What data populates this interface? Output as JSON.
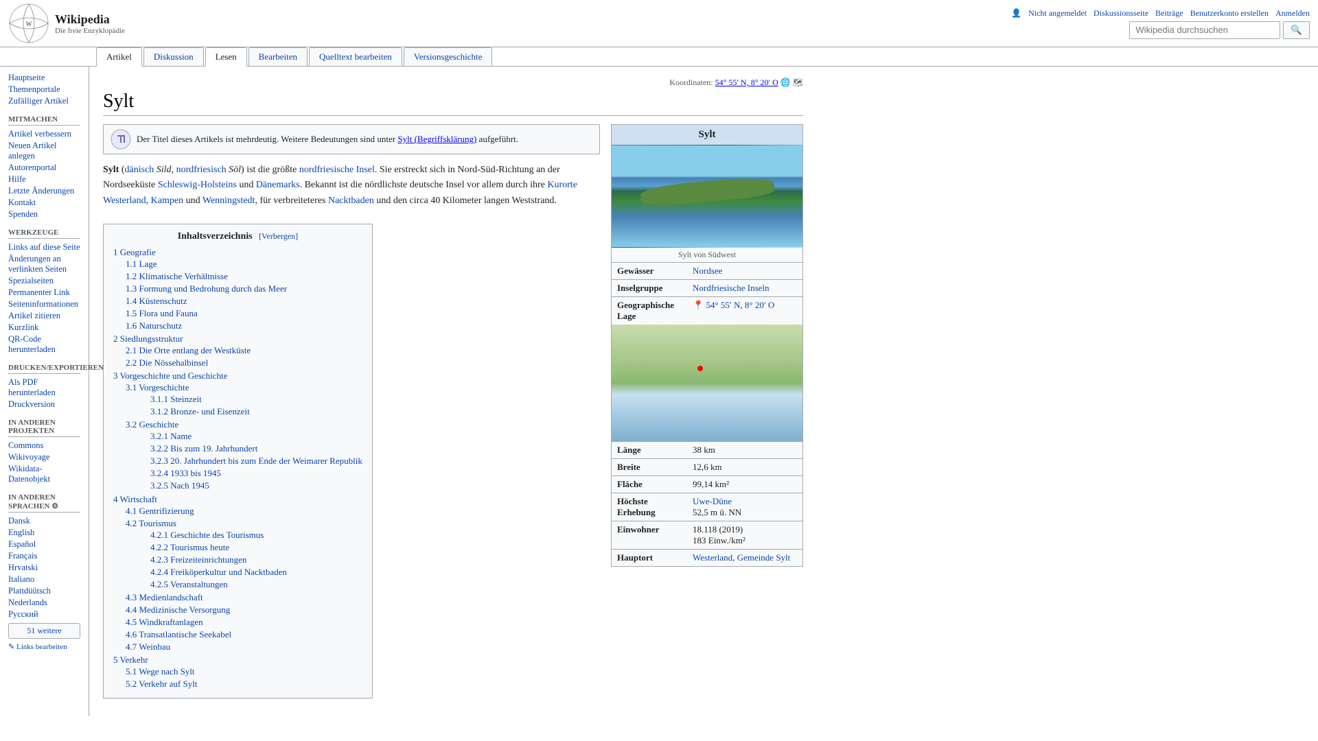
{
  "header": {
    "logo_alt": "Wikipedia",
    "logo_title": "Wikipedia",
    "logo_subtitle": "Die freie Enzyklopädie",
    "user_links": [
      {
        "label": "Nicht angemeldet",
        "href": "#"
      },
      {
        "label": "Diskussionsseite",
        "href": "#"
      },
      {
        "label": "Beiträge",
        "href": "#"
      },
      {
        "label": "Benutzerkonto erstellen",
        "href": "#"
      },
      {
        "label": "Anmelden",
        "href": "#"
      }
    ],
    "search_placeholder": "Wikipedia durchsuchen",
    "search_button_label": "🔍"
  },
  "tabs": [
    {
      "label": "Artikel",
      "active": true
    },
    {
      "label": "Diskussion",
      "active": false
    },
    {
      "label": "Lesen",
      "active": true
    },
    {
      "label": "Bearbeiten",
      "active": false
    },
    {
      "label": "Quelltext bearbeiten",
      "active": false
    },
    {
      "label": "Versionsgeschichte",
      "active": false
    }
  ],
  "sidebar": {
    "sections": [
      {
        "title": "",
        "items": [
          {
            "label": "Hauptseite",
            "href": "#"
          },
          {
            "label": "Themenportale",
            "href": "#"
          },
          {
            "label": "Zufälliger Artikel",
            "href": "#"
          }
        ]
      },
      {
        "title": "Mitmachen",
        "items": [
          {
            "label": "Artikel verbessern",
            "href": "#"
          },
          {
            "label": "Neuen Artikel anlegen",
            "href": "#"
          },
          {
            "label": "Autorenportal",
            "href": "#"
          },
          {
            "label": "Hilfe",
            "href": "#"
          },
          {
            "label": "Letzte Änderungen",
            "href": "#"
          },
          {
            "label": "Kontakt",
            "href": "#"
          },
          {
            "label": "Spenden",
            "href": "#"
          }
        ]
      },
      {
        "title": "Werkzeuge",
        "items": [
          {
            "label": "Links auf diese Seite",
            "href": "#"
          },
          {
            "label": "Änderungen an verlinkten Seiten",
            "href": "#"
          },
          {
            "label": "Spezialseiten",
            "href": "#"
          },
          {
            "label": "Permanenter Link",
            "href": "#"
          },
          {
            "label": "Seiteninformationen",
            "href": "#"
          },
          {
            "label": "Artikel zitieren",
            "href": "#"
          },
          {
            "label": "Kurzlink",
            "href": "#"
          },
          {
            "label": "QR-Code herunterladen",
            "href": "#"
          }
        ]
      },
      {
        "title": "Drucken/exportieren",
        "items": [
          {
            "label": "Als PDF herunterladen",
            "href": "#"
          },
          {
            "label": "Druckversion",
            "href": "#"
          }
        ]
      },
      {
        "title": "In anderen Projekten",
        "items": [
          {
            "label": "Commons",
            "href": "#"
          },
          {
            "label": "Wikivoyage",
            "href": "#"
          },
          {
            "label": "Wikidata-Datenobjekt",
            "href": "#"
          }
        ]
      },
      {
        "title": "In anderen Sprachen",
        "items": [
          {
            "label": "Dansk",
            "href": "#"
          },
          {
            "label": "English",
            "href": "#"
          },
          {
            "label": "Español",
            "href": "#"
          },
          {
            "label": "Français",
            "href": "#"
          },
          {
            "label": "Hrvatski",
            "href": "#"
          },
          {
            "label": "Italiano",
            "href": "#"
          },
          {
            "label": "Plattdüütsch",
            "href": "#"
          },
          {
            "label": "Nederlands",
            "href": "#"
          },
          {
            "label": "Русский",
            "href": "#"
          }
        ],
        "more_label": "51 weitere"
      }
    ],
    "links_bearbeiten": "Links bearbeiten"
  },
  "page": {
    "title": "Sylt",
    "coordinates": "54° 55′ N, 8° 20′ O",
    "disambig_text": "Der Titel dieses Artikels ist mehrdeutig. Weitere Bedeutungen sind unter",
    "disambig_link": "Sylt (Begriffsklärung)",
    "disambig_suffix": "aufgeführt.",
    "intro": "Sylt (dänisch Sild, nordfriesisch Söl) ist die größte nordfriesische Insel. Sie erstreckt sich in Nord-Süd-Richtung an der Nordseeküste Schleswig-Holsteins und Dänemarks. Bekannt ist die nördlichste deutsche Insel vor allem durch ihre Kurorte Westerland, Kampen und Wenningstedt, für verbreiteteres Nacktbaden und den circa 40 Kilometer langen Weststrand."
  },
  "toc": {
    "title": "Inhaltsverzeichnis",
    "hide_label": "[Verbergen]",
    "items": [
      {
        "num": "1",
        "label": "Geografie",
        "sub": [
          {
            "num": "1.1",
            "label": "Lage"
          },
          {
            "num": "1.2",
            "label": "Klimatische Verhältnisse"
          },
          {
            "num": "1.3",
            "label": "Formung und Bedrohung durch das Meer"
          },
          {
            "num": "1.4",
            "label": "Küstenschutz"
          },
          {
            "num": "1.5",
            "label": "Flora und Fauna"
          },
          {
            "num": "1.6",
            "label": "Naturschutz"
          }
        ]
      },
      {
        "num": "2",
        "label": "Siedlungsstruktur",
        "sub": [
          {
            "num": "2.1",
            "label": "Die Orte entlang der Westküste"
          },
          {
            "num": "2.2",
            "label": "Die Nössehalbinsel"
          }
        ]
      },
      {
        "num": "3",
        "label": "Vorgeschichte und Geschichte",
        "sub": [
          {
            "num": "3.1",
            "label": "Vorgeschichte",
            "sub": [
              {
                "num": "3.1.1",
                "label": "Steinzeit"
              },
              {
                "num": "3.1.2",
                "label": "Bronze- und Eisenzeit"
              }
            ]
          },
          {
            "num": "3.2",
            "label": "Geschichte",
            "sub": [
              {
                "num": "3.2.1",
                "label": "Name"
              },
              {
                "num": "3.2.2",
                "label": "Bis zum 19. Jahrhundert"
              },
              {
                "num": "3.2.3",
                "label": "20. Jahrhundert bis zum Ende der Weimarer Republik"
              },
              {
                "num": "3.2.4",
                "label": "1933 bis 1945"
              },
              {
                "num": "3.2.5",
                "label": "Nach 1945"
              }
            ]
          }
        ]
      },
      {
        "num": "4",
        "label": "Wirtschaft",
        "sub": [
          {
            "num": "4.1",
            "label": "Gentrifizierung"
          },
          {
            "num": "4.2",
            "label": "Tourismus",
            "sub": [
              {
                "num": "4.2.1",
                "label": "Geschichte des Tourismus"
              },
              {
                "num": "4.2.2",
                "label": "Tourismus heute"
              },
              {
                "num": "4.2.3",
                "label": "Freizeiteinrichtungen"
              },
              {
                "num": "4.2.4",
                "label": "Freiköperkultur und Nacktbaden"
              },
              {
                "num": "4.2.5",
                "label": "Veranstaltungen"
              }
            ]
          },
          {
            "num": "4.3",
            "label": "Medienlandschaft"
          },
          {
            "num": "4.4",
            "label": "Medizinische Versorgung"
          },
          {
            "num": "4.5",
            "label": "Windkraftanlagen"
          },
          {
            "num": "4.6",
            "label": "Transatlantische Seekabel"
          },
          {
            "num": "4.7",
            "label": "Weinbau"
          }
        ]
      },
      {
        "num": "5",
        "label": "Verkehr",
        "sub": [
          {
            "num": "5.1",
            "label": "Wege nach Sylt"
          },
          {
            "num": "5.2",
            "label": "Verkehr auf Sylt"
          }
        ]
      }
    ]
  },
  "infobox": {
    "title": "Sylt",
    "image_caption": "Sylt von Südwest",
    "rows": [
      {
        "label": "Gewässer",
        "value": "Nordsee",
        "link": true
      },
      {
        "label": "Inselgruppe",
        "value": "Nordfriesische Inseln",
        "link": true
      },
      {
        "label": "Geographische Lage",
        "value": "54° 55′ N, 8° 20′ O",
        "link": true
      },
      {
        "label": "Länge",
        "value": "38 km"
      },
      {
        "label": "Breite",
        "value": "12,6 km"
      },
      {
        "label": "Fläche",
        "value": "99,14 km²"
      },
      {
        "label": "Höchste Erhebung",
        "value": "Uwe-Düne\n52,5 m ü. NN",
        "link": true
      },
      {
        "label": "Einwohner",
        "value": "18.118 (2019)\n183 Einw./km²"
      },
      {
        "label": "Hauptort",
        "value": "Westerland, Gemeinde Sylt",
        "link": true
      }
    ]
  }
}
